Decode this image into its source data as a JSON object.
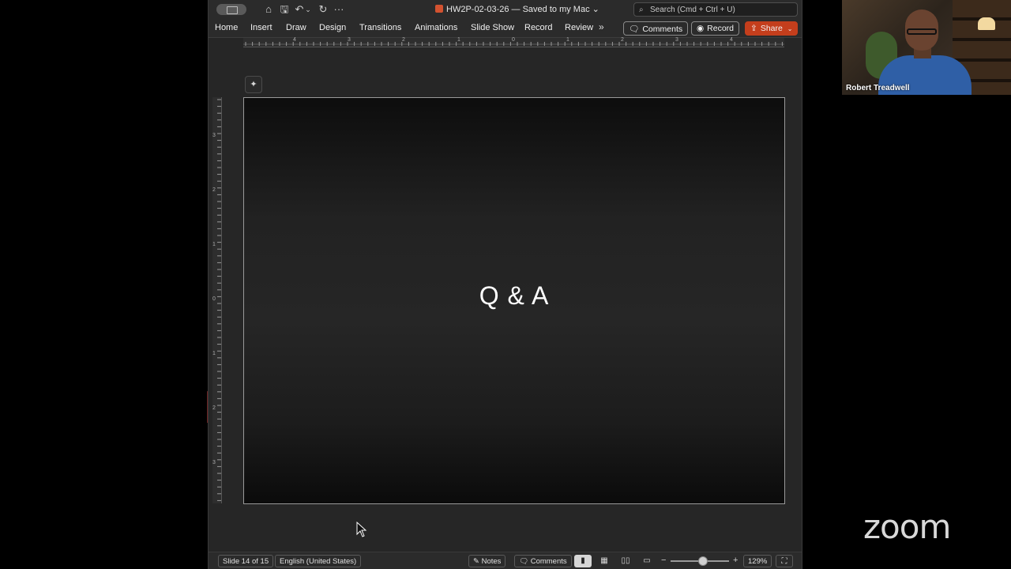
{
  "window": {
    "doc_title": "HW2P-02-03-26 — Saved to my Mac",
    "doc_title_chevron": "⌄",
    "search_placeholder": "Search (Cmd + Ctrl + U)"
  },
  "quick_access": {
    "home_icon": "⌂",
    "save_icon": "🖫",
    "undo_icon": "↶",
    "undo_menu": "⌄",
    "redo_icon": "↻",
    "more_icon": "···"
  },
  "ribbon": {
    "tabs": [
      "Home",
      "Insert",
      "Draw",
      "Design",
      "Transitions",
      "Animations",
      "Slide Show",
      "Record",
      "Review"
    ],
    "more_tabs": "»",
    "comments_label": "Comments",
    "record_label": "Record",
    "share_label": "Share"
  },
  "rulers": {
    "horizontal_labels": [
      "4",
      "3",
      "2",
      "1",
      "0",
      "1",
      "2",
      "3",
      "4"
    ],
    "vertical_labels": [
      "3",
      "2",
      "1",
      "0",
      "1",
      "2",
      "3"
    ]
  },
  "slide": {
    "title": "Q & A"
  },
  "statusbar": {
    "slide_indicator": "Slide 14 of 15",
    "language": "English (United States)",
    "notes_label": "Notes",
    "comments_label": "Comments",
    "zoom_minus": "−",
    "zoom_plus": "+",
    "zoom_level": "129%",
    "zoom_fraction": 0.55
  },
  "video": {
    "participant_name": "Robert Treadwell"
  },
  "branding": {
    "app_logo": "zoom"
  },
  "colors": {
    "share_accent": "#c43e1c",
    "ppt_brand": "#d35230"
  }
}
